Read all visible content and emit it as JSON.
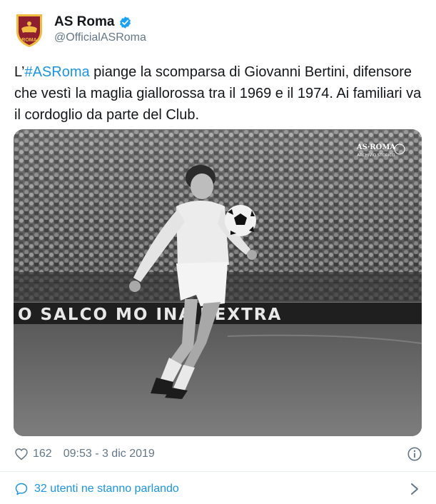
{
  "account": {
    "display_name": "AS Roma",
    "handle": "@OfficialASRoma",
    "verified": true,
    "avatar_icon": "as-roma-crest-icon",
    "avatar_text": "ROMA"
  },
  "tweet": {
    "prefix": "L’",
    "hashtag": "#ASRoma",
    "body": " piange la scomparsa di Giovanni Bertini, difensore che vestì la maglia giallorossa tra il 1969 e il 1974. Ai familiari va il cordoglio da parte del Club."
  },
  "media": {
    "description": "black and white photo of footballer controlling ball",
    "watermark_line1": "AS·ROMA",
    "watermark_line2": "ARCHIVIO STORICO",
    "ad_board_text": "O SALCO MO  INA  I EXTRA"
  },
  "meta": {
    "like_count": "162",
    "timestamp": "09:53 - 3 dic 2019"
  },
  "conversation": {
    "label": "32 utenti ne stanno parlando"
  },
  "colors": {
    "accent": "#1b95e0",
    "secondary_text": "#657786",
    "roma_red": "#8e1f2f",
    "roma_gold": "#f0bc42"
  }
}
